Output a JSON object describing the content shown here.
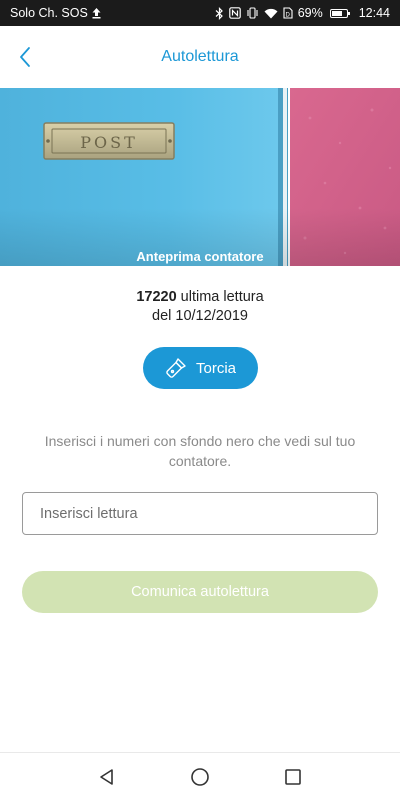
{
  "status_bar": {
    "carrier": "Solo Ch. SOS",
    "battery_percent": "69%",
    "battery_level": 0.69,
    "time": "12:44"
  },
  "header": {
    "title": "Autolettura",
    "back_icon": "chevron-left-icon"
  },
  "hero": {
    "caption": "Anteprima contatore",
    "mailbox_text": "POST"
  },
  "last_reading": {
    "value": "17220",
    "label": "ultima lettura",
    "date_line": "del 10/12/2019"
  },
  "torch": {
    "label": "Torcia",
    "icon": "flashlight-icon"
  },
  "instruction": "Inserisci i numeri con sfondo nero che vedi sul tuo contatore.",
  "reading_input": {
    "placeholder": "Inserisci lettura",
    "value": ""
  },
  "submit": {
    "label": "Comunica autolettura"
  },
  "colors": {
    "accent": "#1c98d6",
    "submit_disabled": "#d2e3b3",
    "instruction_text": "#8a8a8a"
  }
}
